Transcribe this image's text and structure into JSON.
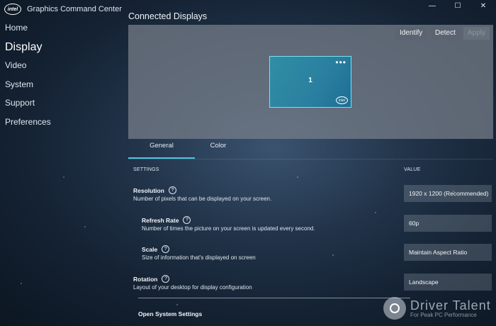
{
  "app": {
    "logo_text": "intel",
    "title": "Graphics Command Center"
  },
  "window_controls": {
    "minimize": "—",
    "maximize": "☐",
    "close": "✕"
  },
  "nav": [
    "Home",
    "Display",
    "Video",
    "System",
    "Support",
    "Preferences"
  ],
  "display": {
    "section_title": "Connected Displays",
    "buttons": {
      "identify": "Identify",
      "detect": "Detect",
      "apply": "Apply"
    },
    "monitor": {
      "number": "1",
      "menu": "•••",
      "logo": "intel"
    }
  },
  "tabs": [
    "General",
    "Color"
  ],
  "columns": {
    "settings": "SETTINGS",
    "value": "VALUE"
  },
  "settings": [
    {
      "title": "Resolution",
      "desc": "Number of pixels that can be displayed on your screen.",
      "value": "1920 x 1200 (Recommended)"
    },
    {
      "title": "Refresh Rate",
      "desc": "Number of times the picture on your screen is updated every second.",
      "value": "60p"
    },
    {
      "title": "Scale",
      "desc": "Size of information that's displayed on screen",
      "value": "Maintain Aspect Ratio"
    },
    {
      "title": "Rotation",
      "desc": "Layout of your desktop for display configuration",
      "value": "Landscape"
    }
  ],
  "open_system_settings": "Open System Settings",
  "watermark": {
    "name": "Driver Talent",
    "tagline": "For Peak PC Performance"
  },
  "colors": {
    "accent": "#4fc3e0",
    "monitor": "#2a7fa0"
  }
}
